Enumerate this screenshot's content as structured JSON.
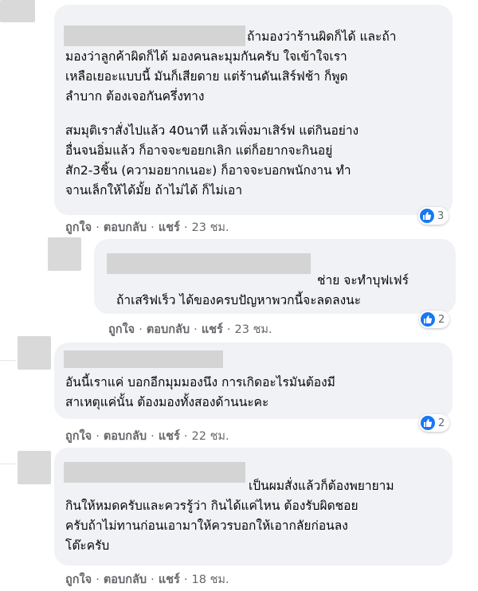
{
  "comments": [
    {
      "text": "ถ้ามองว่าร้านผิดก็ได้ และถ้า\nมองว่าลูกค้าผิดก็ได้ มองคนละมุมกันครับ ใจเข้าใจเรา\nเหลือเยอะแบบนี้ มันก็เสียดาย แต่ร้านดันเสิร์ฟช้า ก็พูด\nลำบาก ต้องเจอกันครึ่งทาง",
      "text2": "สมมุติเราสั่งไปแล้ว 40นาที แล้วเพิ่งมาเสิร์ฟ แต่กินอย่าง\nอื่นจนอิ่มแล้ว ก็อาจจะขอยกเลิก แต่ก็อยากจะกินอยู่\nสัก2-3ชิ้น (ความอยากเนอะ) ก็อาจจะบอกพนักงาน ทำ\nจานเล็กให้ได้มั้ย ถ้าไม่ได้ ก็ไม่เอา",
      "like_label": "ถูกใจ",
      "reply_label": "ตอบกลับ",
      "share_label": "แชร์",
      "time": "23 ชม.",
      "reactions": "3"
    },
    {
      "text": "ช่าย จะทำบุฟเฟร์\nถ้าเสริฟเร็ว ได้ของครบปัญหาพวกนี้จะลดลงนะ",
      "like_label": "ถูกใจ",
      "reply_label": "ตอบกลับ",
      "share_label": "แชร์",
      "time": "23 ชม.",
      "reactions": "2"
    },
    {
      "text": "อันนี้เราแค่ บอกอีกมุมมองนึง การเกิดอะไรมันต้องมี\nสาเหตุแค่นั้น ต้องมองทั้งสองด้านนะคะ",
      "like_label": "ถูกใจ",
      "reply_label": "ตอบกลับ",
      "share_label": "แชร์",
      "time": "22 ชม.",
      "reactions": "2"
    },
    {
      "text": "เป็นผมสั่งแล้วก็ต้องพยายาม\nกินให้หมดครับและควรรู้ว่า กินได้แค่ไหน ต้องรับผิดชอย\nครับถ้าไม่ทานก่อนเอามาให้ควรบอกให้เอากลัยก่อนลง\nโต๊ะครับ",
      "like_label": "ถูกใจ",
      "reply_label": "ตอบกลับ",
      "share_label": "แชร์",
      "time": "18 ชม."
    }
  ],
  "separator": "·",
  "like_icon_color": "#1877f2",
  "bubble_color": "#f0f2f5"
}
